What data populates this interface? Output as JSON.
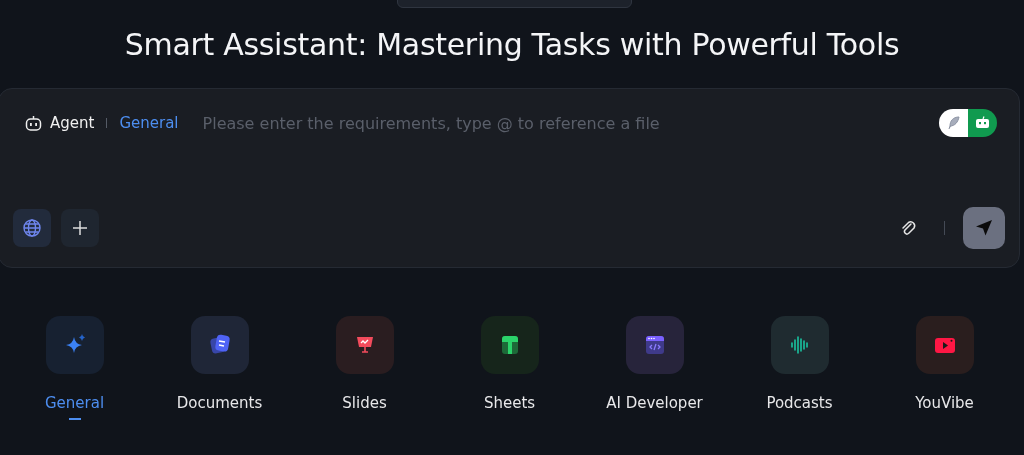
{
  "title": "Smart Assistant: Mastering Tasks with Powerful Tools",
  "composer": {
    "agent_label": "Agent",
    "mode": "General",
    "placeholder": "Please enter the requirements, type @ to reference a file",
    "mode_toggle": [
      {
        "kind": "feather",
        "selected": false
      },
      {
        "kind": "robot",
        "selected": true
      }
    ],
    "web_search": {
      "on": true
    }
  },
  "tools": [
    {
      "label": "General",
      "kind": "sparkle",
      "selected": true
    },
    {
      "label": "Documents",
      "kind": "docs",
      "selected": false
    },
    {
      "label": "Slides",
      "kind": "slides",
      "selected": false
    },
    {
      "label": "Sheets",
      "kind": "sheets",
      "selected": false
    },
    {
      "label": "AI Developer",
      "kind": "code",
      "selected": false
    },
    {
      "label": "Podcasts",
      "kind": "wave",
      "selected": false
    },
    {
      "label": "YouVibe",
      "kind": "video",
      "selected": false
    }
  ]
}
